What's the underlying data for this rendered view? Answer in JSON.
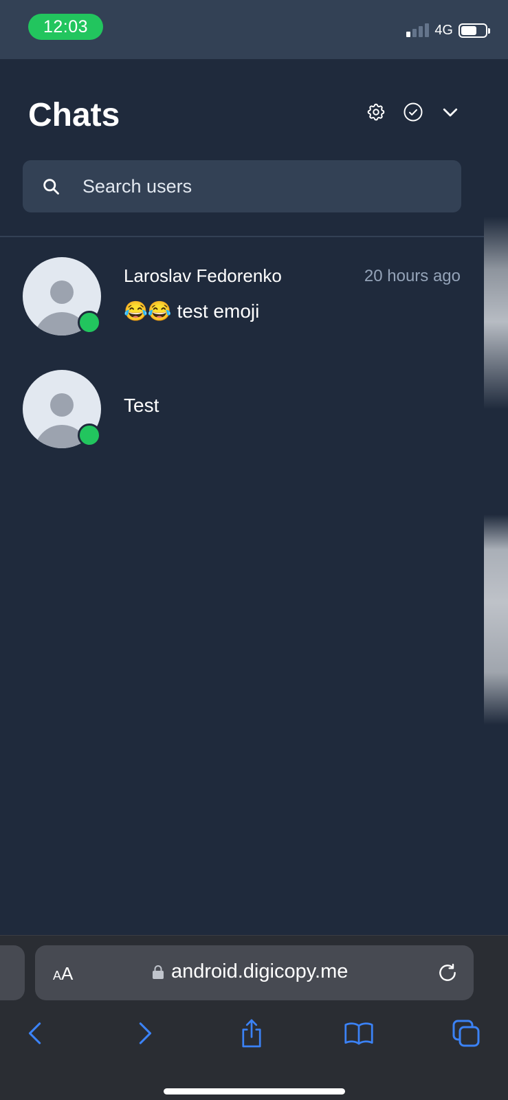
{
  "status_bar": {
    "time": "12:03",
    "network": "4G",
    "signal_bars_active": 1,
    "signal_bars_total": 4,
    "battery_level": 0.6,
    "time_pill_color": "#22c55e"
  },
  "header": {
    "title": "Chats",
    "actions": [
      "gear-icon",
      "check-circle-icon",
      "chevron-down-icon"
    ]
  },
  "search": {
    "placeholder": "Search users",
    "value": ""
  },
  "chats": [
    {
      "name": "Laroslav Fedorenko",
      "time": "20 hours ago",
      "preview": "😂😂 test emoji",
      "online": true
    },
    {
      "name": "Test",
      "time": "",
      "preview": "",
      "online": true
    }
  ],
  "browser": {
    "text_size_label": "AA",
    "url": "android.digicopy.me",
    "toolbar": [
      "back-icon",
      "forward-icon",
      "share-icon",
      "bookmarks-icon",
      "tabs-icon"
    ]
  },
  "colors": {
    "background": "#1f2a3c",
    "surface": "#334155",
    "online": "#22c55e",
    "accent": "#3b82f6",
    "muted_text": "#94a3b8"
  }
}
